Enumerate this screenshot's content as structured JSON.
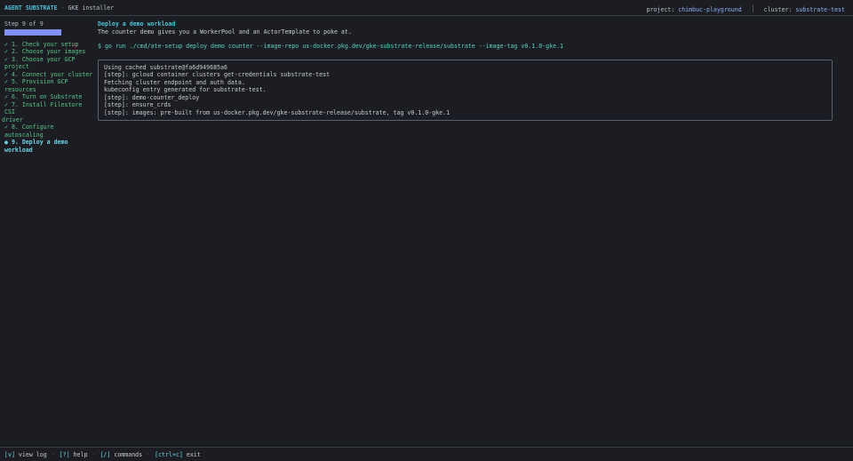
{
  "header": {
    "app_name": "AGENT SUBSTRATE",
    "separator": "·",
    "subtitle": "GKE installer",
    "project_label": "project:",
    "project_value": "chimbuc-playground",
    "cluster_label": "cluster:",
    "cluster_value": "substrate-test"
  },
  "sidebar": {
    "step_counter": "Step 9 of 9",
    "progress_fraction": 1.0,
    "steps": [
      {
        "label": "✓ 1. Check your setup",
        "state": "done"
      },
      {
        "label": "✓ 2. Choose your images",
        "state": "done"
      },
      {
        "label": "✓ 3. Choose your GCP project",
        "state": "done"
      },
      {
        "label": "✓ 4. Connect your cluster",
        "state": "done"
      },
      {
        "label": "✓ 5. Provision GCP resources",
        "state": "done"
      },
      {
        "label": "✓ 6. Turn on Substrate",
        "state": "done"
      },
      {
        "label": "✓ 7. Install Filestore CSI",
        "state": "done"
      },
      {
        "label": "driver",
        "state": "done-wrap"
      },
      {
        "label": "✓ 8. Configure autoscaling",
        "state": "done"
      },
      {
        "label": "● 9. Deploy a demo workload",
        "state": "current"
      }
    ]
  },
  "main": {
    "title": "Deploy a demo workload",
    "description": "The counter demo gives you a WorkerPool and an ActorTemplate to poke at.",
    "command": "$ go run ./cmd/ate-setup deploy demo counter --image-repo us-docker.pkg.dev/gke-substrate-release/substrate --image-tag v0.1.0-gke.1",
    "log_lines": [
      "Using cached substrate@fa6d949685a6",
      "[step]: gcloud container clusters get-credentials substrate-test",
      "Fetching cluster endpoint and auth data.",
      "kubeconfig entry generated for substrate-test.",
      "[step]: demo-counter_deploy",
      "[step]: ensure_crds",
      "[step]: images: pre-built from us-docker.pkg.dev/gke-substrate-release/substrate, tag v0.1.0-gke.1"
    ]
  },
  "footer": {
    "shortcuts": [
      {
        "key": "[v]",
        "label": "view log"
      },
      {
        "key": "[?]",
        "label": "help"
      },
      {
        "key": "[/]",
        "label": "commands"
      },
      {
        "key": "[ctrl+c]",
        "label": "exit"
      }
    ],
    "separator": "·"
  },
  "colors": {
    "background": "#1b1d23",
    "accent": "#4fc3d8",
    "done": "#58c68a",
    "progress": "#7f8ff2"
  }
}
